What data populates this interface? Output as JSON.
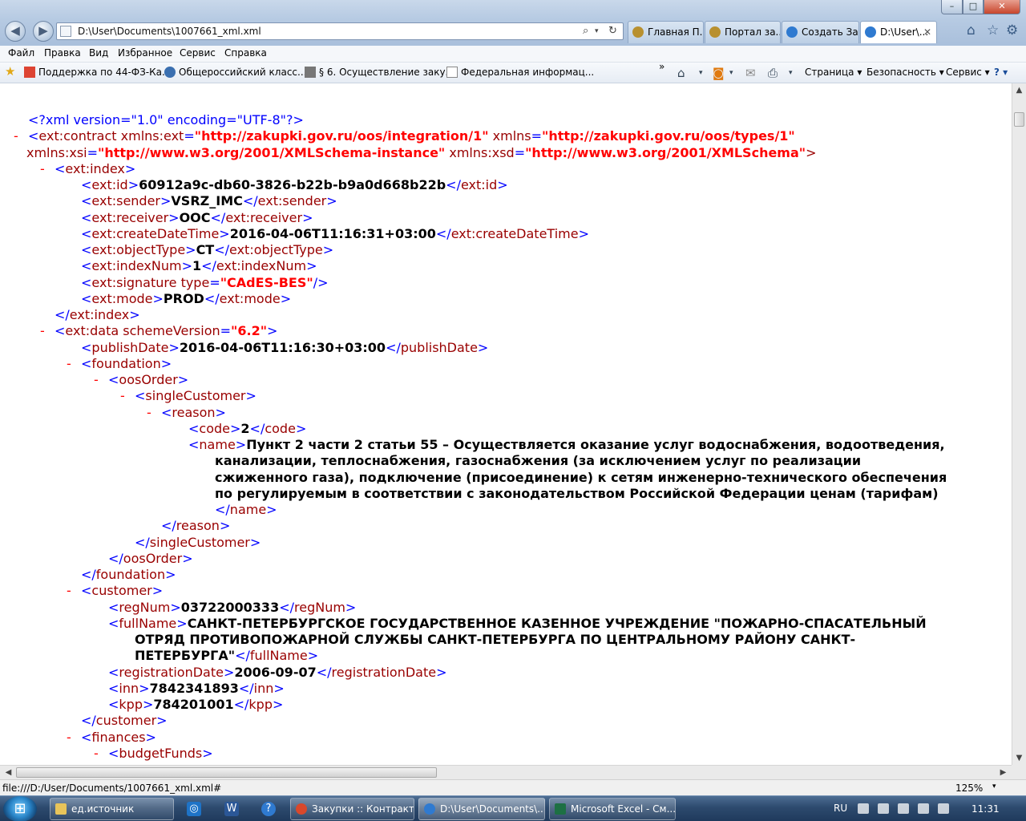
{
  "window": {
    "min_label": "–",
    "max_label": "□",
    "close_label": "✕",
    "back_label": "◀",
    "forward_label": "▶"
  },
  "address": {
    "url": "D:\\User\\Documents\\1007661_xml.xml",
    "search_icon": "⌕",
    "dropdown_icon": "▾",
    "refresh_icon": "↻"
  },
  "tabs": [
    {
      "label": "Главная П...",
      "icon": "emblem-icon"
    },
    {
      "label": "Портал за...",
      "icon": "emblem-icon"
    },
    {
      "label": "Создать За...",
      "icon": "ie-icon"
    },
    {
      "label": "D:\\User\\...",
      "icon": "ie-icon"
    }
  ],
  "tab_close": "✕",
  "right_tools": {
    "home": "⌂",
    "favorites": "☆",
    "tools": "⚙"
  },
  "menu": [
    "Файл",
    "Правка",
    "Вид",
    "Избранное",
    "Сервис",
    "Справка"
  ],
  "favorites": [
    "Поддержка по 44-ФЗ-Ка...",
    "Общероссийский класс...",
    "§ 6. Осуществление заку...",
    "Федеральная информац..."
  ],
  "favorites_more": "»",
  "commands": {
    "page": "Страница ▾",
    "safety": "Безопасность ▾",
    "tools": "Сервис ▾",
    "help": "? ▾"
  },
  "xml_lines": [
    "<?xml version=\"1.0\" encoding=\"UTF-8\"?>",
    "<ext:contract xmlns:ext=\"http://zakupki.gov.ru/oos/integration/1\" xmlns=\"http://zakupki.gov.ru/oos/types/1\"",
    "xmlns:xsi=\"http://www.w3.org/2001/XMLSchema-instance\" xmlns:xsd=\"http://www.w3.org/2001/XMLSchema\">",
    "<ext:index>",
    "<ext:id>60912a9c-db60-3826-b22b-b9a0d668b22b</ext:id>",
    "<ext:sender>VSRZ_IMC</ext:sender>",
    "<ext:receiver>OOC</ext:receiver>",
    "<ext:createDateTime>2016-04-06T11:16:31+03:00</ext:createDateTime>",
    "<ext:objectType>CT</ext:objectType>",
    "<ext:indexNum>1</ext:indexNum>",
    "<ext:signature type=\"CAdES-BES\"/>",
    "<ext:mode>PROD</ext:mode>",
    "</ext:index>",
    "<ext:data schemeVersion=\"6.2\">",
    "<publishDate>2016-04-06T11:16:30+03:00</publishDate>",
    "<foundation>",
    "<oosOrder>",
    "<singleCustomer>",
    "<reason>",
    "<code>2</code>",
    "<name>Пункт 2 части 2 статьи 55 – Осуществляется оказание услуг водоснабжения, водоотведения,",
    "канализации, теплоснабжения, газоснабжения (за исключением услуг по реализации",
    "сжиженного газа), подключение (присоединение) к сетям инженерно-технического обеспечения",
    "по регулируемым в соответствии с законодательством Российской Федерации ценам (тарифам)",
    "</name>",
    "</reason>",
    "</singleCustomer>",
    "</oosOrder>",
    "</foundation>",
    "<customer>",
    "<regNum>03722000333</regNum>",
    "<fullName>САНКТ-ПЕТЕРБУРГСКОЕ ГОСУДАРСТВЕННОЕ КАЗЕННОЕ УЧРЕЖДЕНИЕ \"ПОЖАРНО-СПАСАТЕЛЬНЫЙ",
    "ОТРЯД ПРОТИВОПОЖАРНОЙ СЛУЖБЫ САНКТ-ПЕТЕРБУРГА ПО ЦЕНТРАЛЬНОМУ РАЙОНУ САНКТ-",
    "ПЕТЕРБУРГА\"</fullName>",
    "<registrationDate>2006-09-07</registrationDate>",
    "<inn>7842341893</inn>",
    "<kpp>784201001</kpp>",
    "</customer>",
    "<finances>",
    "<budgetFunds>"
  ],
  "collapse_marker": "-",
  "status": {
    "url": "file:///D:/User/Documents/1007661_xml.xml#",
    "zoom": "125%",
    "zoom_dd": "▾"
  },
  "taskbar": {
    "start": "⊞",
    "buttons": [
      "ед.источник",
      "Закупки :: Контракт...",
      "D:\\User\\Documents\\...",
      "Microsoft Excel - См..."
    ],
    "quick_launch": [
      "outlook-icon",
      "word-icon",
      "help-icon"
    ],
    "language": "RU",
    "clock": "11:31"
  },
  "colors": {
    "tag": "#990000",
    "markup": "#0000ff",
    "attribute_value": "#ff0000",
    "text": "#000000",
    "taskbar": "#2d4a6e"
  }
}
